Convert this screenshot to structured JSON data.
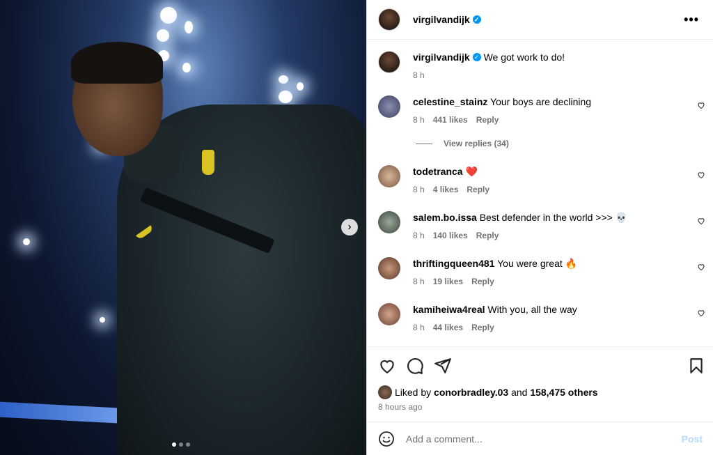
{
  "post": {
    "username": "virgilvandijk",
    "verified_icon": "verified-icon",
    "more_icon": "more-options-icon",
    "more_label": "•••",
    "image_next_label": "›",
    "image_dots": 3
  },
  "caption": {
    "username": "virgilvandijk",
    "text": "We got work to do!",
    "time": "8 h"
  },
  "comments": [
    {
      "username": "celestine_stainz",
      "text": "Your boys are declining",
      "time": "8 h",
      "likes": "441 likes",
      "reply": "Reply",
      "avatar_color": "#6a6f8f"
    },
    {
      "username": "todetranca",
      "text": "❤️",
      "time": "8 h",
      "likes": "4 likes",
      "reply": "Reply",
      "avatar_color": "#c49a7a"
    },
    {
      "username": "salem.bo.issa",
      "text": "Best defender in the world >>> 💀",
      "time": "8 h",
      "likes": "140 likes",
      "reply": "Reply",
      "avatar_color": "#6b7a6b"
    },
    {
      "username": "thriftingqueen481",
      "text": "You were great 🔥",
      "time": "8 h",
      "likes": "19 likes",
      "reply": "Reply",
      "avatar_color": "#8a5a45"
    },
    {
      "username": "kamiheiwa4real",
      "text": "With you, all the way",
      "time": "8 h",
      "likes": "44 likes",
      "reply": "Reply",
      "avatar_color": "#9a6a5a"
    }
  ],
  "view_replies": "View replies (34)",
  "likes_section": {
    "liked_by_prefix": "Liked by",
    "liked_by_user": "conorbradley.03",
    "and": "and",
    "others": "158,475 others",
    "time_ago": "8 hours ago"
  },
  "add_comment": {
    "placeholder": "Add a comment...",
    "post_label": "Post",
    "emoji_icon": "emoji-icon"
  },
  "colors": {
    "accent": "#0095f6",
    "post_disabled": "#b3dbff",
    "meta_text": "#737373"
  }
}
